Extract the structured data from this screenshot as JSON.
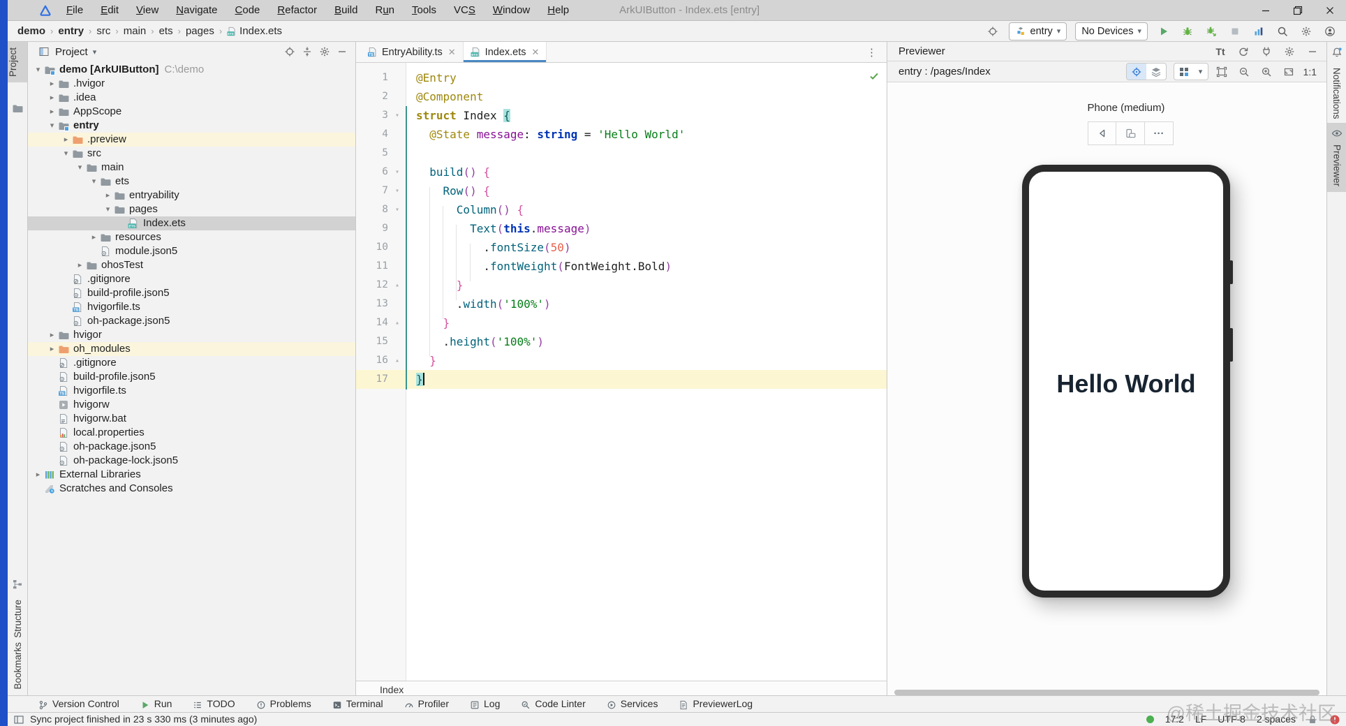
{
  "window": {
    "title": "ArkUIButton - Index.ets [entry]"
  },
  "menus": [
    {
      "label": "File",
      "m": 0
    },
    {
      "label": "Edit",
      "m": 0
    },
    {
      "label": "View",
      "m": 0
    },
    {
      "label": "Navigate",
      "m": 0
    },
    {
      "label": "Code",
      "m": 0
    },
    {
      "label": "Refactor",
      "m": 0
    },
    {
      "label": "Build",
      "m": 0
    },
    {
      "label": "Run",
      "m": 1
    },
    {
      "label": "Tools",
      "m": 0
    },
    {
      "label": "VCS",
      "m": 2
    },
    {
      "label": "Window",
      "m": 0
    },
    {
      "label": "Help",
      "m": 0
    }
  ],
  "breadcrumbs": [
    {
      "label": "demo",
      "bold": true
    },
    {
      "label": "entry",
      "bold": true
    },
    {
      "label": "src"
    },
    {
      "label": "main"
    },
    {
      "label": "ets"
    },
    {
      "label": "pages"
    },
    {
      "label": "Index.ets",
      "icon": "ets"
    }
  ],
  "toolbar": {
    "module_combo": "entry",
    "device_combo": "No Devices"
  },
  "project": {
    "title": "Project",
    "tree": [
      {
        "l": "demo [ArkUIButton]",
        "path": "C:\\demo",
        "d": 0,
        "ch": "v",
        "ic": "folder-module",
        "b": true
      },
      {
        "l": ".hvigor",
        "d": 1,
        "ch": ">",
        "ic": "folder"
      },
      {
        "l": ".idea",
        "d": 1,
        "ch": ">",
        "ic": "folder"
      },
      {
        "l": "AppScope",
        "d": 1,
        "ch": ">",
        "ic": "folder"
      },
      {
        "l": "entry",
        "d": 1,
        "ch": "v",
        "ic": "folder-module",
        "b": true
      },
      {
        "l": ".preview",
        "d": 2,
        "ch": ">",
        "ic": "folder-orange",
        "hl": true
      },
      {
        "l": "src",
        "d": 2,
        "ch": "v",
        "ic": "folder"
      },
      {
        "l": "main",
        "d": 3,
        "ch": "v",
        "ic": "folder"
      },
      {
        "l": "ets",
        "d": 4,
        "ch": "v",
        "ic": "folder"
      },
      {
        "l": "entryability",
        "d": 5,
        "ch": ">",
        "ic": "folder"
      },
      {
        "l": "pages",
        "d": 5,
        "ch": "v",
        "ic": "folder"
      },
      {
        "l": "Index.ets",
        "d": 6,
        "ch": "",
        "ic": "ets",
        "sel": true
      },
      {
        "l": "resources",
        "d": 4,
        "ch": ">",
        "ic": "folder"
      },
      {
        "l": "module.json5",
        "d": 4,
        "ch": "",
        "ic": "json5"
      },
      {
        "l": "ohosTest",
        "d": 3,
        "ch": ">",
        "ic": "folder"
      },
      {
        "l": ".gitignore",
        "d": 2,
        "ch": "",
        "ic": "ignore"
      },
      {
        "l": "build-profile.json5",
        "d": 2,
        "ch": "",
        "ic": "json5"
      },
      {
        "l": "hvigorfile.ts",
        "d": 2,
        "ch": "",
        "ic": "ts"
      },
      {
        "l": "oh-package.json5",
        "d": 2,
        "ch": "",
        "ic": "json5"
      },
      {
        "l": "hvigor",
        "d": 1,
        "ch": ">",
        "ic": "folder"
      },
      {
        "l": "oh_modules",
        "d": 1,
        "ch": ">",
        "ic": "folder-orange",
        "hl": true
      },
      {
        "l": ".gitignore",
        "d": 1,
        "ch": "",
        "ic": "ignore"
      },
      {
        "l": "build-profile.json5",
        "d": 1,
        "ch": "",
        "ic": "json5"
      },
      {
        "l": "hvigorfile.ts",
        "d": 1,
        "ch": "",
        "ic": "ts"
      },
      {
        "l": "hvigorw",
        "d": 1,
        "ch": "",
        "ic": "exec"
      },
      {
        "l": "hvigorw.bat",
        "d": 1,
        "ch": "",
        "ic": "bat"
      },
      {
        "l": "local.properties",
        "d": 1,
        "ch": "",
        "ic": "properties"
      },
      {
        "l": "oh-package.json5",
        "d": 1,
        "ch": "",
        "ic": "json5"
      },
      {
        "l": "oh-package-lock.json5",
        "d": 1,
        "ch": "",
        "ic": "json5"
      },
      {
        "l": "External Libraries",
        "d": 0,
        "ch": ">",
        "ic": "extlib"
      },
      {
        "l": "Scratches and Consoles",
        "d": 0,
        "ch": "",
        "ic": "scratches"
      }
    ]
  },
  "editor": {
    "tabs": [
      {
        "label": "EntryAbility.ts",
        "icon": "ts",
        "active": false
      },
      {
        "label": "Index.ets",
        "icon": "ets",
        "active": true
      }
    ],
    "breadcrumb": "Index",
    "code": {
      "lines": [
        {
          "n": 1,
          "fold": "",
          "segs": [
            [
              "@Entry",
              "ann"
            ]
          ]
        },
        {
          "n": 2,
          "fold": "",
          "segs": [
            [
              "@Component",
              "ann"
            ]
          ]
        },
        {
          "n": 3,
          "fold": "v",
          "segs": [
            [
              "struct",
              "annb"
            ],
            [
              " Index ",
              "pl"
            ],
            [
              "{",
              "brhl"
            ]
          ]
        },
        {
          "n": 4,
          "fold": "",
          "segs": [
            [
              "  ",
              "pl"
            ],
            [
              "@State",
              "ann"
            ],
            [
              " ",
              "pl"
            ],
            [
              "message",
              "fld"
            ],
            [
              ": ",
              "pl"
            ],
            [
              "string",
              "kw"
            ],
            [
              " = ",
              "pl"
            ],
            [
              "'Hello World'",
              "str"
            ]
          ]
        },
        {
          "n": 5,
          "fold": "",
          "segs": []
        },
        {
          "n": 6,
          "fold": "v",
          "segs": [
            [
              "  ",
              "pl"
            ],
            [
              "build",
              "fn"
            ],
            [
              "()",
              "pr"
            ],
            [
              " ",
              "pl"
            ],
            [
              "{",
              "br"
            ]
          ]
        },
        {
          "n": 7,
          "fold": "v",
          "segs": [
            [
              "    ",
              "pl"
            ],
            [
              "Row",
              "fn"
            ],
            [
              "()",
              "pr"
            ],
            [
              " ",
              "pl"
            ],
            [
              "{",
              "br"
            ]
          ]
        },
        {
          "n": 8,
          "fold": "v",
          "segs": [
            [
              "      ",
              "pl"
            ],
            [
              "Column",
              "fn"
            ],
            [
              "()",
              "pr"
            ],
            [
              " ",
              "pl"
            ],
            [
              "{",
              "br"
            ]
          ]
        },
        {
          "n": 9,
          "fold": "",
          "segs": [
            [
              "        ",
              "pl"
            ],
            [
              "Text",
              "fn"
            ],
            [
              "(",
              "pr"
            ],
            [
              "this",
              "kw"
            ],
            [
              ".",
              "pl"
            ],
            [
              "message",
              "fld"
            ],
            [
              ")",
              "pr"
            ]
          ]
        },
        {
          "n": 10,
          "fold": "",
          "segs": [
            [
              "          ",
              "pl"
            ],
            [
              ".",
              "pl"
            ],
            [
              "fontSize",
              "fn"
            ],
            [
              "(",
              "pr"
            ],
            [
              "50",
              "num"
            ],
            [
              ")",
              "pr"
            ]
          ]
        },
        {
          "n": 11,
          "fold": "",
          "segs": [
            [
              "          ",
              "pl"
            ],
            [
              ".",
              "pl"
            ],
            [
              "fontWeight",
              "fn"
            ],
            [
              "(",
              "pr"
            ],
            [
              "FontWeight.Bold",
              "pl"
            ],
            [
              ")",
              "pr"
            ]
          ]
        },
        {
          "n": 12,
          "fold": "^",
          "segs": [
            [
              "      ",
              "pl"
            ],
            [
              "}",
              "br"
            ]
          ]
        },
        {
          "n": 13,
          "fold": "",
          "segs": [
            [
              "      ",
              "pl"
            ],
            [
              ".",
              "pl"
            ],
            [
              "width",
              "fn"
            ],
            [
              "(",
              "pr"
            ],
            [
              "'100%'",
              "str"
            ],
            [
              ")",
              "pr"
            ]
          ]
        },
        {
          "n": 14,
          "fold": "^",
          "segs": [
            [
              "    ",
              "pl"
            ],
            [
              "}",
              "br"
            ]
          ]
        },
        {
          "n": 15,
          "fold": "",
          "segs": [
            [
              "    ",
              "pl"
            ],
            [
              ".",
              "pl"
            ],
            [
              "height",
              "fn"
            ],
            [
              "(",
              "pr"
            ],
            [
              "'100%'",
              "str"
            ],
            [
              ")",
              "pr"
            ]
          ]
        },
        {
          "n": 16,
          "fold": "^",
          "segs": [
            [
              "  ",
              "pl"
            ],
            [
              "}",
              "br"
            ]
          ]
        },
        {
          "n": 17,
          "fold": "",
          "caret": true,
          "segs": [
            [
              "}",
              "brhl"
            ]
          ]
        }
      ]
    }
  },
  "previewer": {
    "title": "Previewer",
    "route": "entry : /pages/Index",
    "tt": "Tt",
    "device_label": "Phone (medium)",
    "more": "···",
    "zoom_ratio": "1:1",
    "phone_text": "Hello World"
  },
  "bottom_tools": [
    {
      "label": "Version Control",
      "icon": "vcs"
    },
    {
      "label": "Run",
      "icon": "run-green"
    },
    {
      "label": "TODO",
      "icon": "todo"
    },
    {
      "label": "Problems",
      "icon": "problems"
    },
    {
      "label": "Terminal",
      "icon": "terminal"
    },
    {
      "label": "Profiler",
      "icon": "gauge"
    },
    {
      "label": "Log",
      "icon": "log"
    },
    {
      "label": "Code Linter",
      "icon": "lint"
    },
    {
      "label": "Services",
      "icon": "services"
    },
    {
      "label": "PreviewerLog",
      "icon": "prevlog"
    }
  ],
  "statusbar": {
    "message": "Sync project finished in 23 s 330 ms (3 minutes ago)",
    "caret": "17:2",
    "line_sep": "LF",
    "encoding": "UTF-8",
    "indent": "2 spaces"
  },
  "stripes": {
    "left": [
      "Project",
      "Structure",
      "Bookmarks"
    ],
    "right": [
      "Notifications",
      "Previewer"
    ]
  },
  "watermark": "@稀土掘金技术社区",
  "colors": {
    "accent_blue": "#4a88c2",
    "run_green": "#59a869",
    "error_red": "#d64f4f",
    "caret_line": "#fcf6d2",
    "selection_gray": "#d2d2d2",
    "highlight_yellow": "#faf5dc",
    "brace_match": "#a9e2dd"
  },
  "icons_legend": {
    "search-icon": "magnifier",
    "gear-icon": "cogwheel",
    "locate-icon": "crosshair",
    "refresh-icon": "circular-arrows",
    "plug-icon": "connector",
    "bell-icon": "notifications",
    "eye-icon": "previewer",
    "back-icon": "triangle-left",
    "rotate-icon": "orientation",
    "bug-icon": "debug",
    "play-icon": "run",
    "stop-icon": "stop-square",
    "lock-icon": "padlock"
  }
}
